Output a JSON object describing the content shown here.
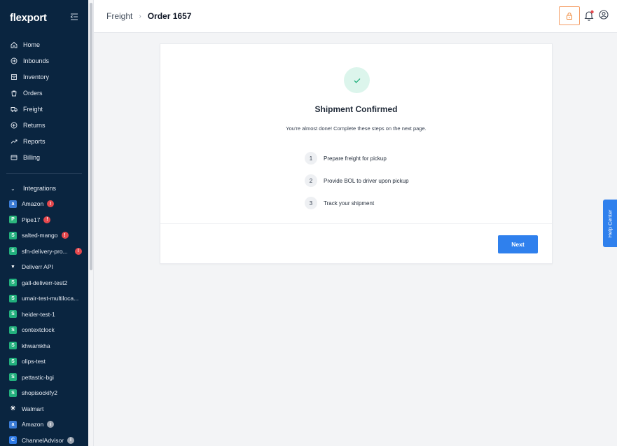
{
  "brand": {
    "name": "flexport"
  },
  "nav": {
    "items": [
      {
        "label": "Home",
        "icon": "home-icon"
      },
      {
        "label": "Inbounds",
        "icon": "inbounds-icon"
      },
      {
        "label": "Inventory",
        "icon": "inventory-icon"
      },
      {
        "label": "Orders",
        "icon": "orders-icon"
      },
      {
        "label": "Freight",
        "icon": "freight-icon"
      },
      {
        "label": "Returns",
        "icon": "returns-icon"
      },
      {
        "label": "Reports",
        "icon": "reports-icon"
      },
      {
        "label": "Billing",
        "icon": "billing-icon"
      }
    ],
    "integrations_label": "Integrations",
    "integrations": [
      {
        "label": "Amazon",
        "icon": "amazon-icon",
        "icon_glyph": "a",
        "alert": "!"
      },
      {
        "label": "Pipe17",
        "icon": "pipe17-icon",
        "icon_glyph": "P",
        "alert": "!"
      },
      {
        "label": "salted-mango",
        "icon": "shopify-icon",
        "icon_glyph": "S",
        "alert": "!"
      },
      {
        "label": "sfn-delivery-pro...",
        "icon": "shopify-icon",
        "icon_glyph": "S",
        "alert": "!"
      },
      {
        "label": "Deliverr API",
        "icon": "deliverr-icon",
        "icon_glyph": "▼",
        "alert": ""
      },
      {
        "label": "gall-deliverr-test2",
        "icon": "shopify-icon",
        "icon_glyph": "S",
        "alert": ""
      },
      {
        "label": "umair-test-multiloca...",
        "icon": "shopify-icon",
        "icon_glyph": "S",
        "alert": ""
      },
      {
        "label": "heider-test-1",
        "icon": "shopify-icon",
        "icon_glyph": "S",
        "alert": ""
      },
      {
        "label": "contextclock",
        "icon": "shopify-icon",
        "icon_glyph": "S",
        "alert": ""
      },
      {
        "label": "khwamkha",
        "icon": "shopify-icon",
        "icon_glyph": "S",
        "alert": ""
      },
      {
        "label": "olips-test",
        "icon": "shopify-icon",
        "icon_glyph": "S",
        "alert": ""
      },
      {
        "label": "pettastic-bgi",
        "icon": "shopify-icon",
        "icon_glyph": "S",
        "alert": ""
      },
      {
        "label": "shopisockify2",
        "icon": "shopify-icon",
        "icon_glyph": "S",
        "alert": ""
      },
      {
        "label": "Walmart",
        "icon": "walmart-icon",
        "icon_glyph": "✳",
        "alert": ""
      },
      {
        "label": "Amazon",
        "icon": "amazon-icon",
        "icon_glyph": "a",
        "alert": "i"
      },
      {
        "label": "ChannelAdvisor",
        "icon": "channeladvisor-icon",
        "icon_glyph": "C",
        "alert": "i"
      }
    ]
  },
  "header": {
    "breadcrumb_parent": "Freight",
    "breadcrumb_separator": "›",
    "breadcrumb_current": "Order 1657"
  },
  "card": {
    "title": "Shipment Confirmed",
    "subtitle": "You're almost done! Complete these steps on the next page.",
    "steps": [
      {
        "num": "1",
        "text": "Prepare freight for pickup"
      },
      {
        "num": "2",
        "text": "Provide BOL to driver upon pickup"
      },
      {
        "num": "3",
        "text": "Track your shipment"
      }
    ],
    "next_label": "Next"
  },
  "help_tab": {
    "label": "Help Center"
  },
  "colors": {
    "sidebar": "#0a2540",
    "primary": "#2f80ed",
    "success_bg": "#dcf5ec",
    "success": "#22b07d",
    "alert": "#e5484d",
    "lock_border": "#f59e66"
  }
}
